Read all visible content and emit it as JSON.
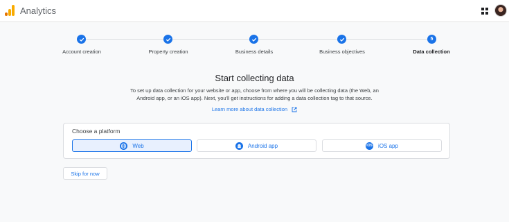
{
  "app": {
    "title": "Analytics"
  },
  "colors": {
    "accent": "#1a73e8",
    "selected_bg": "#e8f0fe",
    "logo_orange": "#f9ab00",
    "logo_dark": "#e37400"
  },
  "stepper": {
    "steps": [
      {
        "label": "Account creation",
        "state": "complete",
        "icon": "check-icon"
      },
      {
        "label": "Property creation",
        "state": "complete",
        "icon": "check-icon"
      },
      {
        "label": "Business details",
        "state": "complete",
        "icon": "check-icon"
      },
      {
        "label": "Business objectives",
        "state": "complete",
        "icon": "check-icon"
      },
      {
        "label": "Data collection",
        "state": "current",
        "number": "5"
      }
    ]
  },
  "main": {
    "heading": "Start collecting data",
    "description": "To set up data collection for your website or app, choose from where you will be collecting data (the Web, an Android app, or an iOS app). Next, you'll get instructions for adding a data collection tag to that source.",
    "learn_more": "Learn more about data collection"
  },
  "platform": {
    "label": "Choose a platform",
    "options": [
      {
        "label": "Web",
        "icon": "globe-icon",
        "selected": true
      },
      {
        "label": "Android app",
        "icon": "android-icon",
        "selected": false
      },
      {
        "label": "iOS app",
        "icon": "ios-icon",
        "icon_text": "iOS",
        "selected": false
      }
    ]
  },
  "skip": {
    "label": "Skip for now"
  }
}
